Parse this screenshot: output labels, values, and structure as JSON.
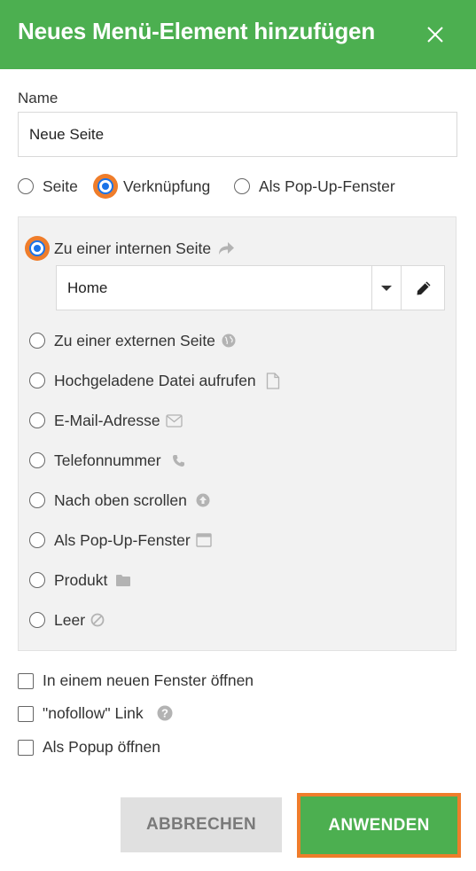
{
  "dialog": {
    "title": "Neues Menü-Element hinzufügen",
    "accent_color": "#4caf50",
    "focus_color": "#ef7d2b",
    "close_icon": "close-icon"
  },
  "name_field": {
    "label": "Name",
    "value": "Neue Seite"
  },
  "type_options": {
    "selected": "Verknüpfung",
    "items": [
      {
        "label": "Seite",
        "checked": false
      },
      {
        "label": "Verknüpfung",
        "checked": true
      },
      {
        "label": "Als Pop-Up-Fenster",
        "checked": false
      }
    ]
  },
  "link_options": {
    "selected": "Zu einer internen Seite",
    "items": [
      {
        "label": "Zu einer internen Seite",
        "icon": "share-arrow-icon",
        "checked": true
      },
      {
        "label": "Zu einer externen Seite",
        "icon": "globe-icon",
        "checked": false
      },
      {
        "label": "Hochgeladene Datei aufrufen",
        "icon": "file-icon",
        "checked": false
      },
      {
        "label": "E-Mail-Adresse",
        "icon": "envelope-icon",
        "checked": false
      },
      {
        "label": "Telefonnummer",
        "icon": "phone-icon",
        "checked": false
      },
      {
        "label": "Nach oben scrollen",
        "icon": "arrow-up-circle-icon",
        "checked": false
      },
      {
        "label": "Als Pop-Up-Fenster",
        "icon": "window-icon",
        "checked": false
      },
      {
        "label": "Produkt",
        "icon": "folder-icon",
        "checked": false
      },
      {
        "label": "Leer",
        "icon": "ban-icon",
        "checked": false
      }
    ],
    "page_select": {
      "value": "Home",
      "edit_icon": "pencil-icon",
      "caret_icon": "caret-down-icon"
    }
  },
  "checkboxes": [
    {
      "label": "In einem neuen Fenster öffnen",
      "checked": false
    },
    {
      "label": "\"nofollow\" Link",
      "checked": false,
      "help_icon": "question-circle-icon"
    },
    {
      "label": "Als Popup öffnen",
      "checked": false
    }
  ],
  "buttons": {
    "cancel": "ABBRECHEN",
    "apply": "ANWENDEN"
  }
}
